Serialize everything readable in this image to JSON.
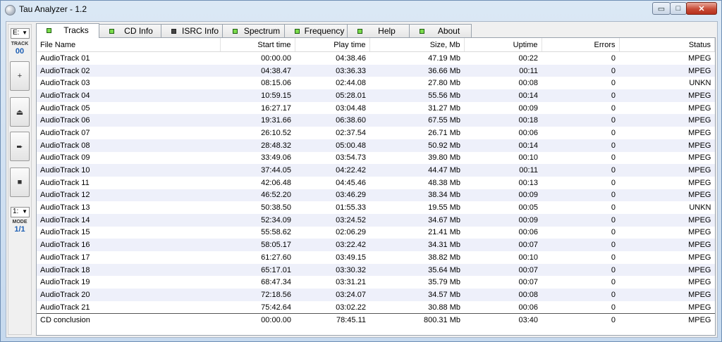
{
  "window": {
    "title": "Tau Analyzer - 1.2",
    "controls": {
      "minimize": "▭",
      "maximize": "□",
      "close": "✕"
    }
  },
  "toolbar": {
    "drive": "E:",
    "track_label": "TRACK",
    "track_value": "00",
    "buttons": [
      {
        "name": "add-button",
        "glyph": "+"
      },
      {
        "name": "eject-button",
        "glyph": "⏏"
      },
      {
        "name": "play-button",
        "glyph": "➨"
      },
      {
        "name": "stop-button",
        "glyph": "■"
      }
    ],
    "mode_select": "1:",
    "mode_label": "MODE",
    "mode_value": "1/1"
  },
  "tabs": [
    {
      "label": "Tracks",
      "led": "green"
    },
    {
      "label": "CD Info",
      "led": "green"
    },
    {
      "label": "ISRC Info",
      "led": "black"
    },
    {
      "label": "Spectrum",
      "led": "green"
    },
    {
      "label": "Frequency",
      "led": "green"
    },
    {
      "label": "Help",
      "led": "green"
    },
    {
      "label": "About",
      "led": "green"
    }
  ],
  "table": {
    "columns": [
      "File Name",
      "Start time",
      "Play time",
      "Size, Mb",
      "Uptime",
      "Errors",
      "Status"
    ],
    "rows": [
      [
        "AudioTrack 01",
        "00:00.00",
        "04:38.46",
        "47.19 Mb",
        "00:22",
        "0",
        "MPEG"
      ],
      [
        "AudioTrack 02",
        "04:38.47",
        "03:36.33",
        "36.66 Mb",
        "00:11",
        "0",
        "MPEG"
      ],
      [
        "AudioTrack 03",
        "08:15.06",
        "02:44.08",
        "27.80 Mb",
        "00:08",
        "0",
        "UNKN"
      ],
      [
        "AudioTrack 04",
        "10:59.15",
        "05:28.01",
        "55.56 Mb",
        "00:14",
        "0",
        "MPEG"
      ],
      [
        "AudioTrack 05",
        "16:27.17",
        "03:04.48",
        "31.27 Mb",
        "00:09",
        "0",
        "MPEG"
      ],
      [
        "AudioTrack 06",
        "19:31.66",
        "06:38.60",
        "67.55 Mb",
        "00:18",
        "0",
        "MPEG"
      ],
      [
        "AudioTrack 07",
        "26:10.52",
        "02:37.54",
        "26.71 Mb",
        "00:06",
        "0",
        "MPEG"
      ],
      [
        "AudioTrack 08",
        "28:48.32",
        "05:00.48",
        "50.92 Mb",
        "00:14",
        "0",
        "MPEG"
      ],
      [
        "AudioTrack 09",
        "33:49.06",
        "03:54.73",
        "39.80 Mb",
        "00:10",
        "0",
        "MPEG"
      ],
      [
        "AudioTrack 10",
        "37:44.05",
        "04:22.42",
        "44.47 Mb",
        "00:11",
        "0",
        "MPEG"
      ],
      [
        "AudioTrack 11",
        "42:06.48",
        "04:45.46",
        "48.38 Mb",
        "00:13",
        "0",
        "MPEG"
      ],
      [
        "AudioTrack 12",
        "46:52.20",
        "03:46.29",
        "38.34 Mb",
        "00:09",
        "0",
        "MPEG"
      ],
      [
        "AudioTrack 13",
        "50:38.50",
        "01:55.33",
        "19.55 Mb",
        "00:05",
        "0",
        "UNKN"
      ],
      [
        "AudioTrack 14",
        "52:34.09",
        "03:24.52",
        "34.67 Mb",
        "00:09",
        "0",
        "MPEG"
      ],
      [
        "AudioTrack 15",
        "55:58.62",
        "02:06.29",
        "21.41 Mb",
        "00:06",
        "0",
        "MPEG"
      ],
      [
        "AudioTrack 16",
        "58:05.17",
        "03:22.42",
        "34.31 Mb",
        "00:07",
        "0",
        "MPEG"
      ],
      [
        "AudioTrack 17",
        "61:27.60",
        "03:49.15",
        "38.82 Mb",
        "00:10",
        "0",
        "MPEG"
      ],
      [
        "AudioTrack 18",
        "65:17.01",
        "03:30.32",
        "35.64 Mb",
        "00:07",
        "0",
        "MPEG"
      ],
      [
        "AudioTrack 19",
        "68:47.34",
        "03:31.21",
        "35.79 Mb",
        "00:07",
        "0",
        "MPEG"
      ],
      [
        "AudioTrack 20",
        "72:18.56",
        "03:24.07",
        "34.57 Mb",
        "00:08",
        "0",
        "MPEG"
      ],
      [
        "AudioTrack 21",
        "75:42.64",
        "03:02.22",
        "30.88 Mb",
        "00:06",
        "0",
        "MPEG"
      ]
    ],
    "summary": [
      "CD conclusion",
      "00:00.00",
      "78:45.11",
      "800.31 Mb",
      "03:40",
      "0",
      "MPEG"
    ]
  }
}
